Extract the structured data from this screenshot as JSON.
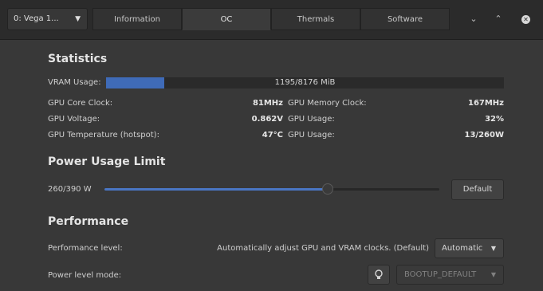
{
  "header": {
    "gpu_select": "0: Vega 1...",
    "tabs": [
      {
        "label": "Information"
      },
      {
        "label": "OC"
      },
      {
        "label": "Thermals"
      },
      {
        "label": "Software"
      }
    ],
    "active_tab": "OC"
  },
  "statistics": {
    "title": "Statistics",
    "vram_label": "VRAM Usage:",
    "vram_text": "1195/8176 MiB",
    "vram_used": 1195,
    "vram_total": 8176,
    "rows": [
      {
        "left_label": "GPU Core Clock:",
        "left_value": "81MHz",
        "right_label": "GPU Memory Clock:",
        "right_value": "167MHz"
      },
      {
        "left_label": "GPU Voltage:",
        "left_value": "0.862V",
        "right_label": "GPU Usage:",
        "right_value": "32%"
      },
      {
        "left_label": "GPU Temperature (hotspot):",
        "left_value": "47°C",
        "right_label": "GPU Usage:",
        "right_value": "13/260W"
      }
    ]
  },
  "power": {
    "title": "Power Usage Limit",
    "label": "260/390 W",
    "current": 260,
    "max": 390,
    "default_button": "Default"
  },
  "performance": {
    "title": "Performance",
    "level_label": "Performance level:",
    "level_description": "Automatically adjust GPU and VRAM clocks. (Default)",
    "level_value": "Automatic",
    "mode_label": "Power level mode:",
    "mode_value": "BOOTUP_DEFAULT"
  },
  "colors": {
    "accent": "#3f6bb8",
    "background": "#383838",
    "header": "#2b2b2b"
  }
}
